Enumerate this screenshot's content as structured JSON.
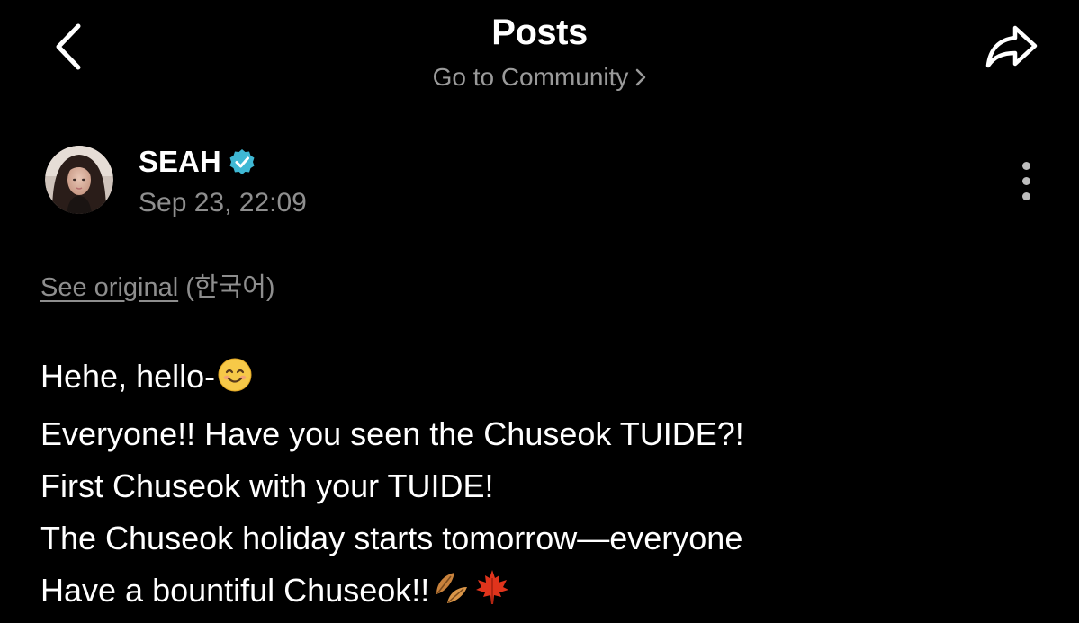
{
  "header": {
    "title": "Posts",
    "community_link": "Go to Community",
    "back_icon": "chevron-left-icon",
    "share_icon": "share-arrow-icon",
    "forward_chevron_icon": "chevron-right-icon"
  },
  "author": {
    "name": "SEAH",
    "verified": true,
    "verified_icon": "verified-badge-icon",
    "date": "Sep 23, 22:09",
    "avatar": "avatar-photo"
  },
  "post": {
    "see_original_label": "See original",
    "original_language": "(한국어)",
    "lines": [
      "Hehe, hello-",
      "Everyone!! Have you seen the Chuseok TUIDE?!",
      "First Chuseok with your TUIDE!",
      "The Chuseok holiday starts tomorrow—everyone",
      "Have a bountiful Chuseok!!"
    ],
    "emojis": {
      "line1": "smiling-face-emoji",
      "line5": [
        "falling-leaves-emoji",
        "maple-leaf-emoji"
      ]
    }
  },
  "menu": {
    "more_icon": "more-vertical-icon"
  },
  "colors": {
    "background": "#000000",
    "primary_text": "#ffffff",
    "secondary_text": "#8e8e8e",
    "verified_badge": "#3fb8d4"
  }
}
